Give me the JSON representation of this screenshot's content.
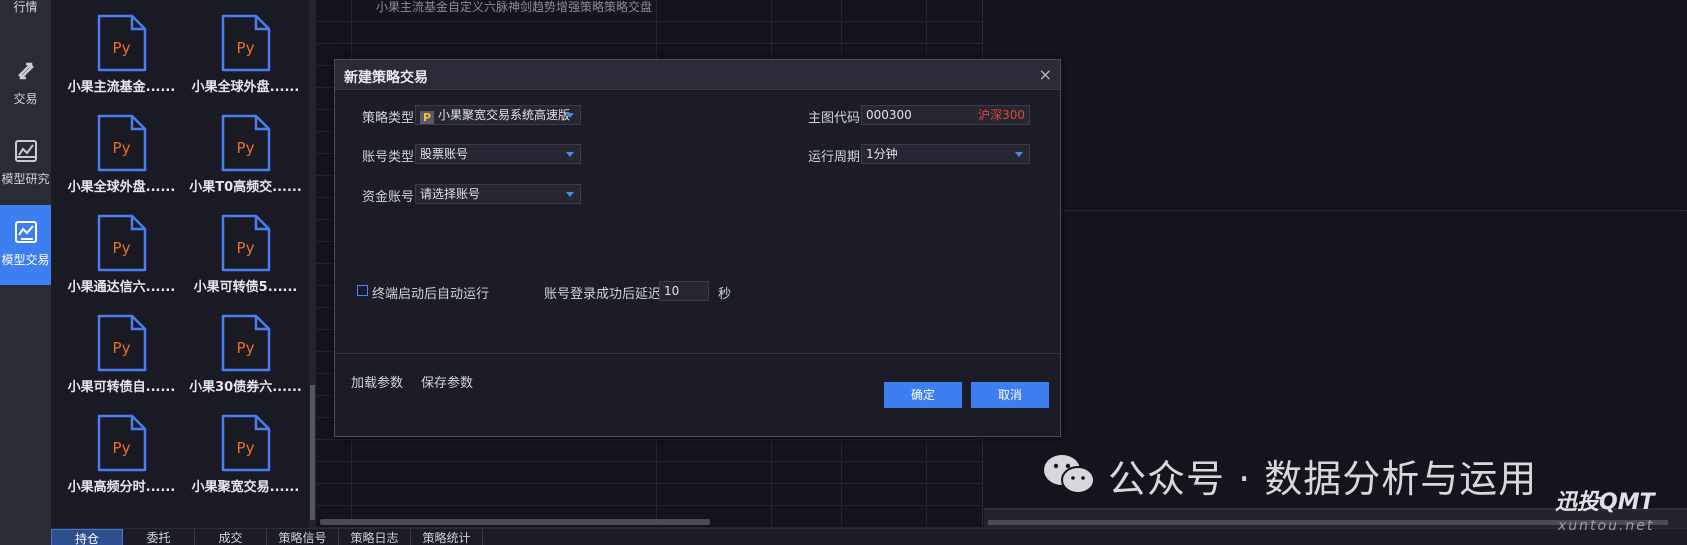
{
  "nav": {
    "items": [
      {
        "label": "行情",
        "icon": "chart-icon"
      },
      {
        "label": "交易",
        "icon": "swap-icon"
      },
      {
        "label": "模型研究",
        "icon": "research-icon"
      },
      {
        "label": "模型交易",
        "icon": "model-trade-icon",
        "active": true
      }
    ]
  },
  "files": [
    {
      "icon_text": "Py",
      "name": "小果主流基金......"
    },
    {
      "icon_text": "Py",
      "name": "小果全球外盘......"
    },
    {
      "icon_text": "Py",
      "name": "小果全球外盘......"
    },
    {
      "icon_text": "Py",
      "name": "小果T0高频交......"
    },
    {
      "icon_text": "Py",
      "name": "小果通达信六......"
    },
    {
      "icon_text": "Py",
      "name": "小果可转债5......"
    },
    {
      "icon_text": "Py",
      "name": "小果可转债自......"
    },
    {
      "icon_text": "Py",
      "name": "小果30债券六......"
    },
    {
      "icon_text": "Py",
      "name": "小果高频分时......"
    },
    {
      "icon_text": "Py",
      "name": "小果聚宽交易......"
    }
  ],
  "table": {
    "top_row_text": "小果主流基金自定义六脉神剑趋势增强策略策略交盘"
  },
  "dialog": {
    "title": "新建策略交易",
    "close": "×",
    "strategy_type_label": "策略类型",
    "strategy_type_value": "小果聚宽交易系统高速版",
    "strategy_type_icon": "P",
    "account_type_label": "账号类型",
    "account_type_value": "股票账号",
    "fund_account_label": "资金账号",
    "fund_account_value": "请选择账号",
    "main_code_label": "主图代码",
    "main_code_value": "000300",
    "main_code_name": "沪深300",
    "period_label": "运行周期",
    "period_value": "1分钟",
    "autostart_label": "终端启动后自动运行",
    "delay_label": "账号登录成功后延迟",
    "delay_value": "10",
    "delay_unit": "秒",
    "load_params": "加载参数",
    "save_params": "保存参数",
    "ok": "确定",
    "cancel": "取消"
  },
  "tabs": [
    {
      "label": "持仓",
      "active": true
    },
    {
      "label": "委托"
    },
    {
      "label": "成交"
    },
    {
      "label": "策略信号"
    },
    {
      "label": "策略日志"
    },
    {
      "label": "策略统计"
    }
  ],
  "watermark": {
    "text": "公众号 · 数据分析与运用",
    "brand": "迅投QMT",
    "url": "xuntou.net"
  },
  "colors": {
    "accent": "#3d7ef0",
    "file_icon": "#4a7ef0",
    "py_text": "#e8702a",
    "code_name": "#e04a3a"
  }
}
